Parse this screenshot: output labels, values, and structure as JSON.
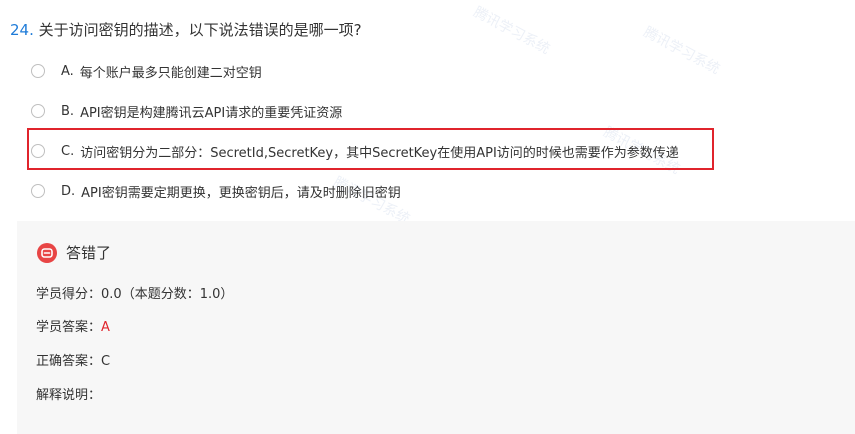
{
  "question": {
    "number": "24.",
    "text": "关于访问密钥的描述，以下说法错误的是哪一项?"
  },
  "options": [
    {
      "letter": "A.",
      "text": "每个账户最多只能创建二对空钥"
    },
    {
      "letter": "B.",
      "text": "API密钥是构建腾讯云API请求的重要凭证资源"
    },
    {
      "letter": "C.",
      "text": "访问密钥分为二部分：SecretId,SecretKey，其中SecretKey在使用API访问的时候也需要作为参数传递"
    },
    {
      "letter": "D.",
      "text": "API密钥需要定期更换，更换密钥后，请及时删除旧密钥"
    }
  ],
  "result": {
    "title": "答错了",
    "score_label": "学员得分：",
    "score_value": "0.0（本题分数：1.0）",
    "student_answer_label": "学员答案：",
    "student_answer_value": "A",
    "correct_answer_label": "正确答案：",
    "correct_answer_value": "C",
    "explanation_label": "解释说明："
  },
  "colors": {
    "question_number": "#1e7bd8",
    "wrong_icon": "#e84545",
    "highlight_border": "#e0242c",
    "student_answer": "#e0242c",
    "panel_background": "#f7f7f7"
  },
  "icons": {
    "result": "wrong-answer-icon",
    "option_marker": "radio-button"
  }
}
